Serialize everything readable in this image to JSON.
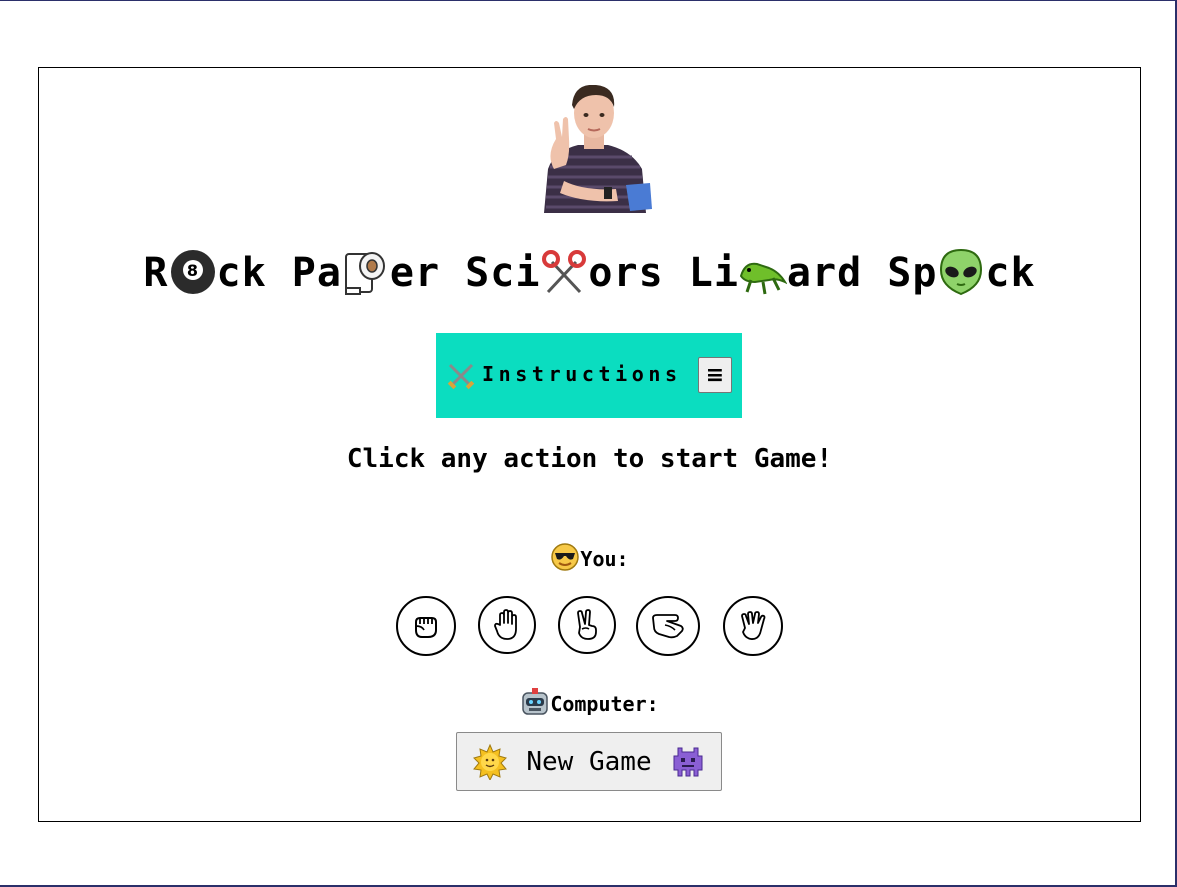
{
  "title": {
    "segments": [
      "R",
      "ck Pa",
      "er Sci",
      "ors Li",
      "ard Sp",
      "ck"
    ],
    "emoji_icons": [
      "8-ball-icon",
      "toilet-paper-icon",
      "scissors-icon",
      "lizard-icon",
      "alien-icon"
    ]
  },
  "instructions": {
    "label": "Instructions",
    "icon": "crossed-swords-icon",
    "menu_icon": "≡",
    "bg_color": "#0bddc0"
  },
  "prompt": "Click any action to start Game!",
  "you": {
    "label": "You:",
    "icon": "sunglasses-face-icon"
  },
  "actions": [
    {
      "name": "rock",
      "icon": "fist-icon"
    },
    {
      "name": "paper",
      "icon": "raised-hand-icon"
    },
    {
      "name": "scissors",
      "icon": "victory-hand-icon"
    },
    {
      "name": "lizard",
      "icon": "lizard-hand-icon"
    },
    {
      "name": "spock",
      "icon": "vulcan-salute-icon"
    }
  ],
  "computer": {
    "label": "Computer:",
    "icon": "robot-face-icon"
  },
  "new_game": {
    "label": "New Game",
    "left_icon": "sun-face-icon",
    "right_icon": "space-invader-icon"
  }
}
